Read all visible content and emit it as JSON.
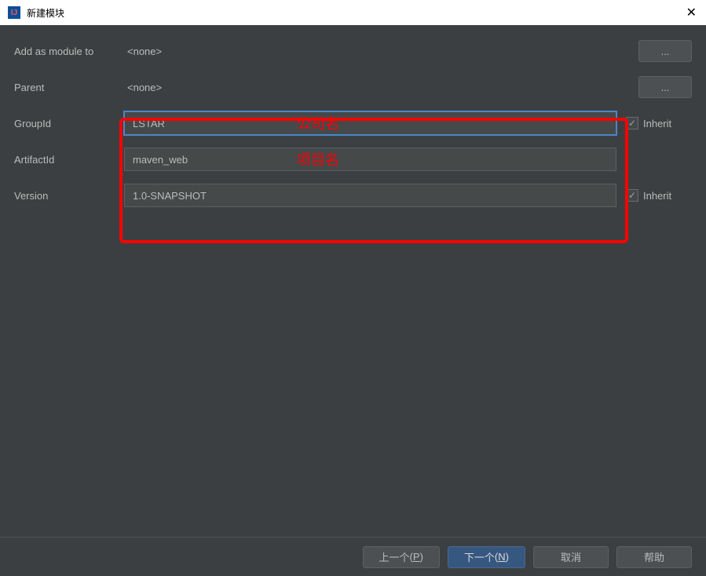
{
  "window": {
    "title": "新建模块",
    "close_glyph": "✕"
  },
  "fields": {
    "add_as_module_to": {
      "label": "Add as module to",
      "value": "<none>",
      "browse": "..."
    },
    "parent": {
      "label": "Parent",
      "value": "<none>",
      "browse": "..."
    },
    "group_id": {
      "label": "GroupId",
      "value": "LSTAR",
      "inherit": "Inherit"
    },
    "artifact_id": {
      "label": "ArtifactId",
      "value": "maven_web"
    },
    "version": {
      "label": "Version",
      "value": "1.0-SNAPSHOT",
      "inherit": "Inherit"
    }
  },
  "annotations": {
    "company": "公司名",
    "project": "项目名"
  },
  "checkmark": "✓",
  "footer": {
    "prev": "上一个",
    "prev_key": "P",
    "next": "下一个",
    "next_key": "N",
    "cancel": "取消",
    "help": "帮助"
  }
}
